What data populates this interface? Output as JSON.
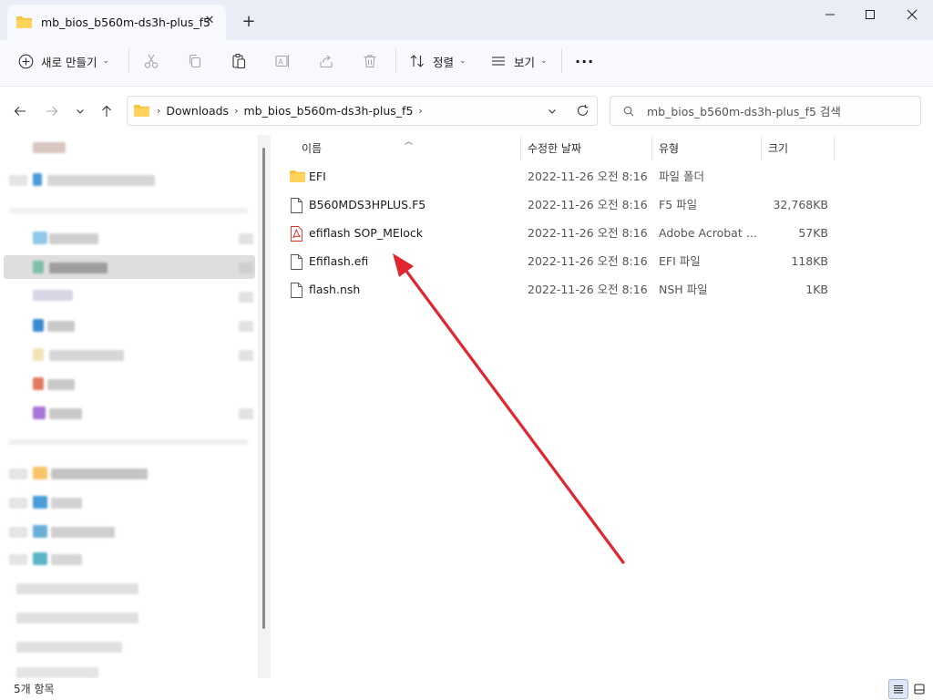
{
  "window": {
    "tab_title": "mb_bios_b560m-ds3h-plus_f5",
    "tab_close": "✕",
    "new_tab": "+",
    "minimize": "—",
    "maximize": "☐",
    "close": "✕"
  },
  "toolbar": {
    "new_label": "새로 만들기",
    "sort_label": "정렬",
    "view_label": "보기",
    "more": "···"
  },
  "address": {
    "crumbs": [
      "Downloads",
      "mb_bios_b560m-ds3h-plus_f5"
    ],
    "search_placeholder": "mb_bios_b560m-ds3h-plus_f5 검색"
  },
  "columns": {
    "name": "이름",
    "date": "수정한 날짜",
    "type": "유형",
    "size": "크기"
  },
  "files": [
    {
      "name": "EFI",
      "date": "2022-11-26 오전 8:16",
      "type": "파일 폴더",
      "size": "",
      "icon": "folder-icon"
    },
    {
      "name": "B560MDS3HPLUS.F5",
      "date": "2022-11-26 오전 8:16",
      "type": "F5 파일",
      "size": "32,768KB",
      "icon": "file-icon"
    },
    {
      "name": "efiflash SOP_MElock",
      "date": "2022-11-26 오전 8:16",
      "type": "Adobe Acrobat 문...",
      "size": "57KB",
      "icon": "pdf-icon"
    },
    {
      "name": "Efiflash.efi",
      "date": "2022-11-26 오전 8:16",
      "type": "EFI 파일",
      "size": "118KB",
      "icon": "file-icon"
    },
    {
      "name": "flash.nsh",
      "date": "2022-11-26 오전 8:16",
      "type": "NSH 파일",
      "size": "1KB",
      "icon": "file-icon"
    }
  ],
  "status": {
    "item_count": "5개 항목"
  },
  "colors": {
    "folder": "#f4c542",
    "pdf": "#d9302c",
    "arrow": "#e02631",
    "selection": "#dedede"
  }
}
